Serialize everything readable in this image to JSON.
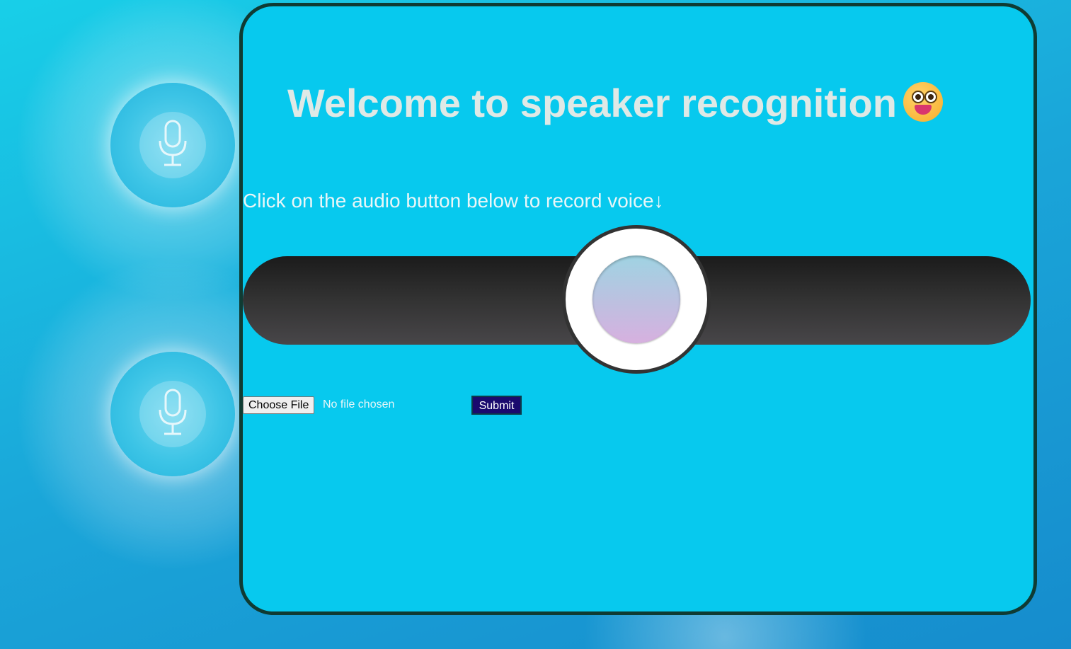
{
  "page": {
    "title": "Welcome to speaker recognition",
    "title_emoji": "grinning-face-emoji",
    "instruction": "Click on the audio button below to record voice↓"
  },
  "recorder": {
    "icon": "record-circle"
  },
  "upload": {
    "choose_file_label": "Choose File",
    "file_status": "No file chosen",
    "submit_label": "Submit"
  },
  "colors": {
    "panel_background": "#07c9ee",
    "panel_border": "#0f3b33",
    "title_text": "#dfe9e6",
    "submit_background": "#1a0a6e"
  }
}
